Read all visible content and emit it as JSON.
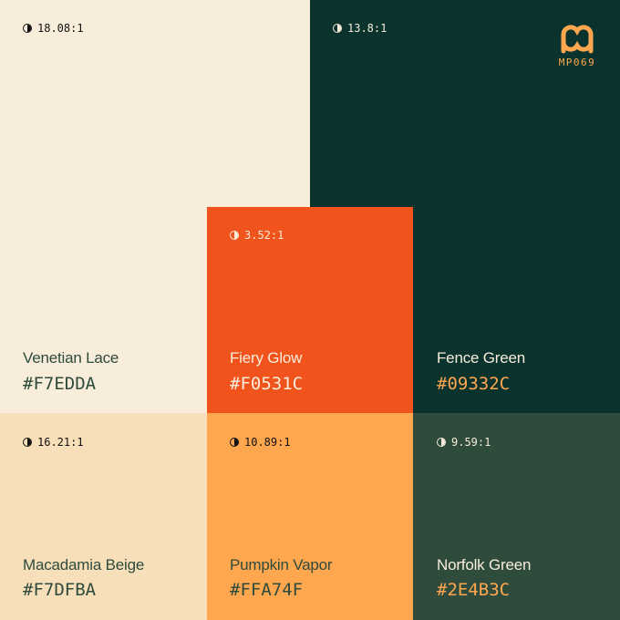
{
  "swatches": {
    "venetian_lace": {
      "ratio": "18.08:1",
      "name": "Venetian Lace",
      "hex": "#F7EDDA",
      "color": "#F7EDDA",
      "text_color": "#2E4B3C",
      "ratio_color": "#111111"
    },
    "fence_green": {
      "ratio": "13.8:1",
      "name": "Fence Green",
      "hex": "#09332C",
      "color": "#09332C",
      "text_color": "#F7EDDA",
      "hex_color": "#FFA74F",
      "ratio_color": "#F7EDDA"
    },
    "fiery_glow": {
      "ratio": "3.52:1",
      "name": "Fiery Glow",
      "hex": "#F0531C",
      "color": "#F0531C",
      "text_color": "#F7EDDA",
      "ratio_color": "#F7EDDA"
    },
    "macadamia_beige": {
      "ratio": "16.21:1",
      "name": "Macadamia Beige",
      "hex": "#F7DFBA",
      "color": "#F7DFBA",
      "text_color": "#2E4B3C",
      "ratio_color": "#111111"
    },
    "pumpkin_vapor": {
      "ratio": "10.89:1",
      "name": "Pumpkin Vapor",
      "hex": "#FFA74F",
      "color": "#FFA74F",
      "text_color": "#2E4B3C",
      "ratio_color": "#111111"
    },
    "norfolk_green": {
      "ratio": "9.59:1",
      "name": "Norfolk Green",
      "hex": "#2E4B3C",
      "color": "#2E4B3C",
      "text_color": "#F7EDDA",
      "hex_color": "#FFA74F",
      "ratio_color": "#F7EDDA"
    }
  },
  "logo": {
    "text": "MP069",
    "color": "#FFA74F",
    "icon": "mp-logo-icon"
  }
}
